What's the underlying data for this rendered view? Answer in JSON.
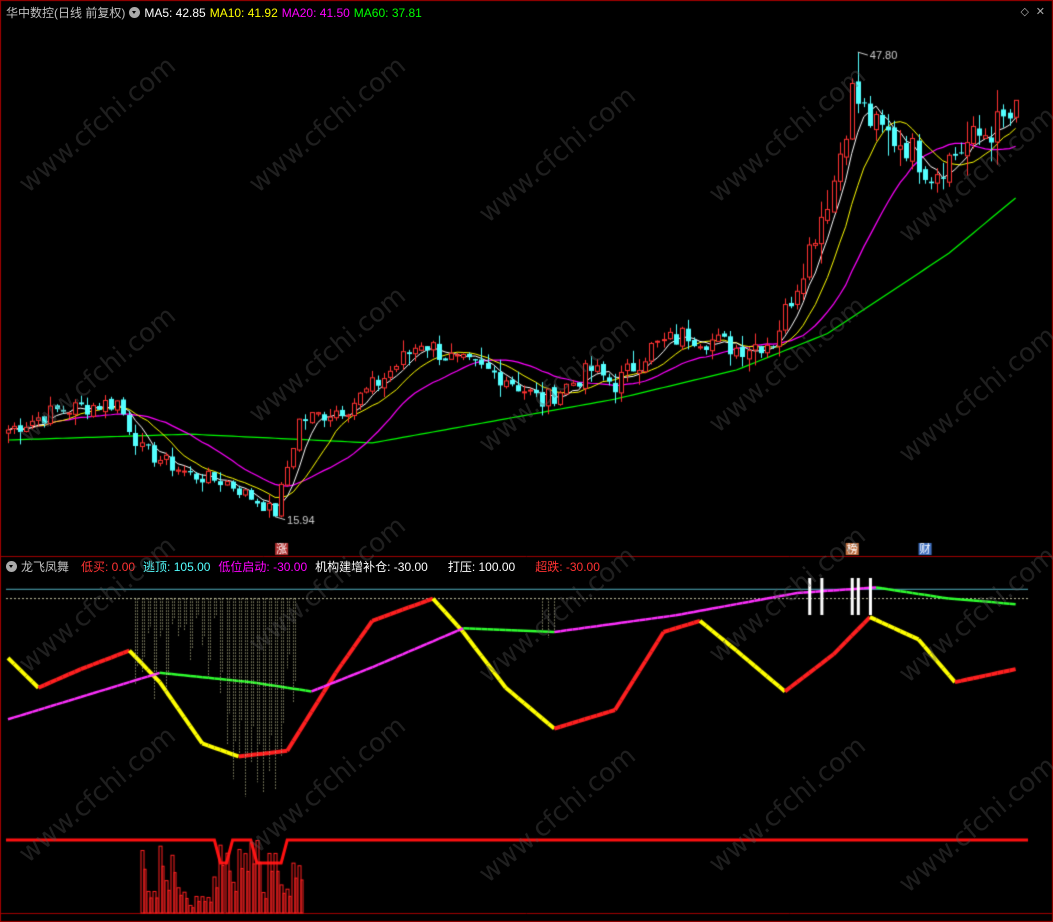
{
  "main_header": {
    "title": "华中数控(日线 前复权)",
    "ma5": "MA5: 42.85",
    "ma10": "MA10: 41.92",
    "ma20": "MA20: 41.50",
    "ma60": "MA60: 37.81"
  },
  "sub_header": {
    "title": "龙飞凤舞",
    "buy": "低买: 0.00",
    "escape": "逃顶: 105.00",
    "low_start": "低位启动: -30.00",
    "inst_add": "机构建增补仓: -30.00",
    "pressure": "打压: 100.00",
    "oversold": "超跌: -30.00"
  },
  "watermark": "www.cfchi.com",
  "colors": {
    "ma5": "#ffffff",
    "ma10": "#ffff00",
    "ma20": "#ff00ff",
    "ma60": "#00ff00",
    "up": "#ff3232",
    "down": "#54ffff",
    "title": "#c0c0c0",
    "buy": "#ff3232",
    "escape": "#54ffff",
    "low_start": "#ff00ff",
    "inst_add": "#ffffff",
    "pressure": "#ffffff",
    "oversold": "#ff3232"
  },
  "chart_data": [
    {
      "type": "candlestick",
      "title": "华中数控(日线 前复权)",
      "ylim": [
        14,
        50
      ],
      "annotations": [
        {
          "text": "47.80",
          "x": 140,
          "y": 47.8
        },
        {
          "text": "15.94",
          "x": 44,
          "y": 15.94
        }
      ],
      "event_markers": [
        {
          "text": "涨",
          "x": 45
        },
        {
          "text": "榜",
          "x": 139
        },
        {
          "text": "财",
          "x": 151
        }
      ],
      "key_closes": [
        [
          0,
          21.9
        ],
        [
          8,
          23.2
        ],
        [
          18,
          23.8
        ],
        [
          22,
          20.5
        ],
        [
          30,
          18.8
        ],
        [
          36,
          18.3
        ],
        [
          44,
          16.2
        ],
        [
          48,
          22.5
        ],
        [
          56,
          23.5
        ],
        [
          62,
          25.5
        ],
        [
          68,
          28.0
        ],
        [
          74,
          26.5
        ],
        [
          82,
          25.5
        ],
        [
          88,
          23.8
        ],
        [
          96,
          26.0
        ],
        [
          100,
          25.0
        ],
        [
          106,
          27.5
        ],
        [
          112,
          28.5
        ],
        [
          120,
          27.5
        ],
        [
          126,
          28.0
        ],
        [
          130,
          32.0
        ],
        [
          136,
          39.0
        ],
        [
          139,
          45.0
        ],
        [
          143,
          42.5
        ],
        [
          148,
          41.5
        ],
        [
          152,
          39.5
        ],
        [
          158,
          41.5
        ],
        [
          162,
          42.5
        ],
        [
          166,
          43.5
        ]
      ],
      "ma60_points": [
        [
          0,
          21.2
        ],
        [
          30,
          21.6
        ],
        [
          60,
          21.0
        ],
        [
          100,
          24.0
        ],
        [
          120,
          26.0
        ],
        [
          135,
          28.5
        ],
        [
          155,
          34.0
        ],
        [
          166,
          37.8
        ]
      ]
    },
    {
      "type": "line",
      "title": "龙飞凤舞",
      "series": [
        {
          "name": "龙飞凤舞"
        }
      ],
      "reference_levels": [
        105,
        100
      ],
      "wave_points": [
        [
          0,
          68
        ],
        [
          5,
          52
        ],
        [
          12,
          62
        ],
        [
          20,
          72
        ],
        [
          25,
          55
        ],
        [
          32,
          22
        ],
        [
          38,
          15
        ],
        [
          46,
          18
        ],
        [
          54,
          60
        ],
        [
          60,
          88
        ],
        [
          70,
          100
        ],
        [
          75,
          82
        ],
        [
          82,
          52
        ],
        [
          90,
          30
        ],
        [
          100,
          40
        ],
        [
          108,
          82
        ],
        [
          114,
          88
        ],
        [
          120,
          72
        ],
        [
          128,
          50
        ],
        [
          136,
          70
        ],
        [
          142,
          90
        ],
        [
          150,
          78
        ],
        [
          156,
          55
        ],
        [
          166,
          62
        ]
      ],
      "slow_points": [
        [
          0,
          35
        ],
        [
          10,
          45
        ],
        [
          25,
          60
        ],
        [
          40,
          55
        ],
        [
          50,
          50
        ],
        [
          60,
          63
        ],
        [
          75,
          84
        ],
        [
          90,
          82
        ],
        [
          110,
          91
        ],
        [
          130,
          103
        ],
        [
          143,
          106
        ],
        [
          155,
          100
        ],
        [
          166,
          97
        ]
      ],
      "bottom_band": {
        "baseline_ranges": [
          [
            0,
            33
          ],
          [
            36,
            40
          ],
          [
            46,
            168
          ]
        ],
        "dip_ranges": [
          [
            34,
            35
          ],
          [
            41,
            45
          ]
        ]
      },
      "white_signal_x": [
        132,
        134,
        139,
        140,
        142
      ]
    }
  ]
}
